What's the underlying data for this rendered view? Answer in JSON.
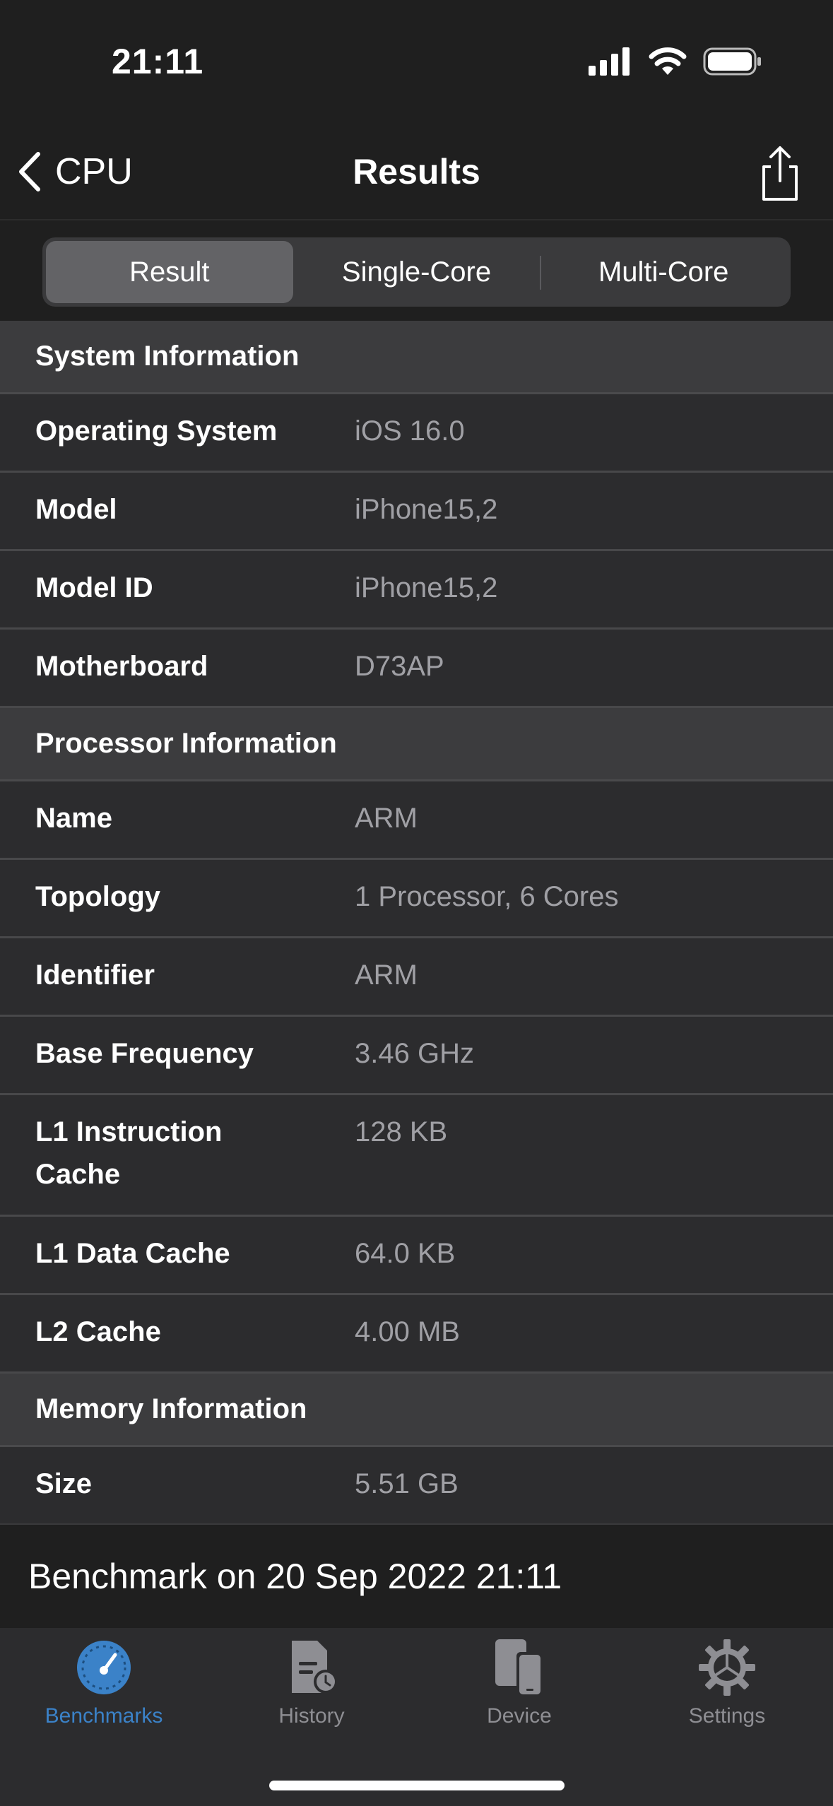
{
  "status_bar": {
    "time": "21:11"
  },
  "nav": {
    "back_label": "CPU",
    "title": "Results"
  },
  "segments": [
    {
      "label": "Result",
      "active": true
    },
    {
      "label": "Single-Core",
      "active": false
    },
    {
      "label": "Multi-Core",
      "active": false
    }
  ],
  "sections": {
    "system": {
      "title": "System Information",
      "rows": [
        {
          "label": "Operating System",
          "value": "iOS 16.0"
        },
        {
          "label": "Model",
          "value": "iPhone15,2"
        },
        {
          "label": "Model ID",
          "value": "iPhone15,2"
        },
        {
          "label": "Motherboard",
          "value": "D73AP"
        }
      ]
    },
    "processor": {
      "title": "Processor Information",
      "rows": [
        {
          "label": "Name",
          "value": "ARM"
        },
        {
          "label": "Topology",
          "value": "1 Processor, 6 Cores"
        },
        {
          "label": "Identifier",
          "value": "ARM"
        },
        {
          "label": "Base Frequency",
          "value": "3.46 GHz"
        },
        {
          "label": "L1 Instruction Cache",
          "value": "128 KB"
        },
        {
          "label": "L1 Data Cache",
          "value": "64.0 KB"
        },
        {
          "label": "L2 Cache",
          "value": "4.00 MB"
        }
      ]
    },
    "memory": {
      "title": "Memory Information",
      "rows": [
        {
          "label": "Size",
          "value": "5.51 GB"
        }
      ]
    }
  },
  "footer": {
    "benchmark_label": "Benchmark on 20 Sep 2022 21:11"
  },
  "tabs": [
    {
      "label": "Benchmarks",
      "icon": "speedometer-icon",
      "active": true
    },
    {
      "label": "History",
      "icon": "history-icon",
      "active": false
    },
    {
      "label": "Device",
      "icon": "device-icon",
      "active": false
    },
    {
      "label": "Settings",
      "icon": "gear-icon",
      "active": false
    }
  ],
  "colors": {
    "accent": "#3b82c8",
    "background": "#1f1f1f",
    "row": "#2c2c2e",
    "section_header": "#3c3c3e",
    "value_text": "#a0a0a5"
  }
}
